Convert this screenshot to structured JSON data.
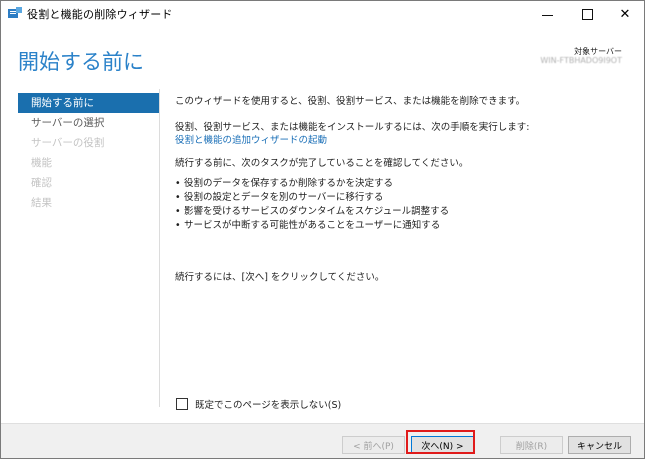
{
  "window": {
    "title": "役割と機能の削除ウィザード",
    "controls": {
      "minimize": "minimize-icon",
      "maximize": "maximize-icon",
      "close": "✕"
    }
  },
  "header": {
    "page_title": "開始する前に",
    "destination_label": "対象サーバー",
    "destination_value": "WIN-FTBHADO9I9OT"
  },
  "nav": {
    "items": [
      {
        "label": "開始する前に",
        "state": "active"
      },
      {
        "label": "サーバーの選択",
        "state": "enabled"
      },
      {
        "label": "サーバーの役割",
        "state": "disabled"
      },
      {
        "label": "機能",
        "state": "disabled"
      },
      {
        "label": "確認",
        "state": "disabled"
      },
      {
        "label": "結果",
        "state": "disabled"
      }
    ]
  },
  "content": {
    "intro": "このウィザードを使用すると、役割、役割サービス、または機能を削除できます。",
    "install_note": "役割、役割サービス、または機能をインストールするには、次の手順を実行します:",
    "install_link": "役割と機能の追加ウィザードの起動",
    "confirm_heading": "続行する前に、次のタスクが完了していることを確認してください。",
    "bullets": [
      "役割のデータを保存するか削除するかを決定する",
      "役割の設定とデータを別のサーバーに移行する",
      "影響を受けるサービスのダウンタイムをスケジュール調整する",
      "サービスが中断する可能性があることをユーザーに通知する"
    ],
    "continue_note": "続行するには、[次へ] をクリックしてください。",
    "skip_checkbox_label": "既定でこのページを表示しない(S)"
  },
  "footer": {
    "prev_label": "< 前へ(P)",
    "next_label": "次へ(N) >",
    "remove_label": "削除(R)",
    "cancel_label": "キャンセル"
  },
  "colors": {
    "accent": "#2b82c9",
    "nav_active": "#1a6fae",
    "link": "#1a6fb7",
    "highlight": "#e01b1b"
  }
}
